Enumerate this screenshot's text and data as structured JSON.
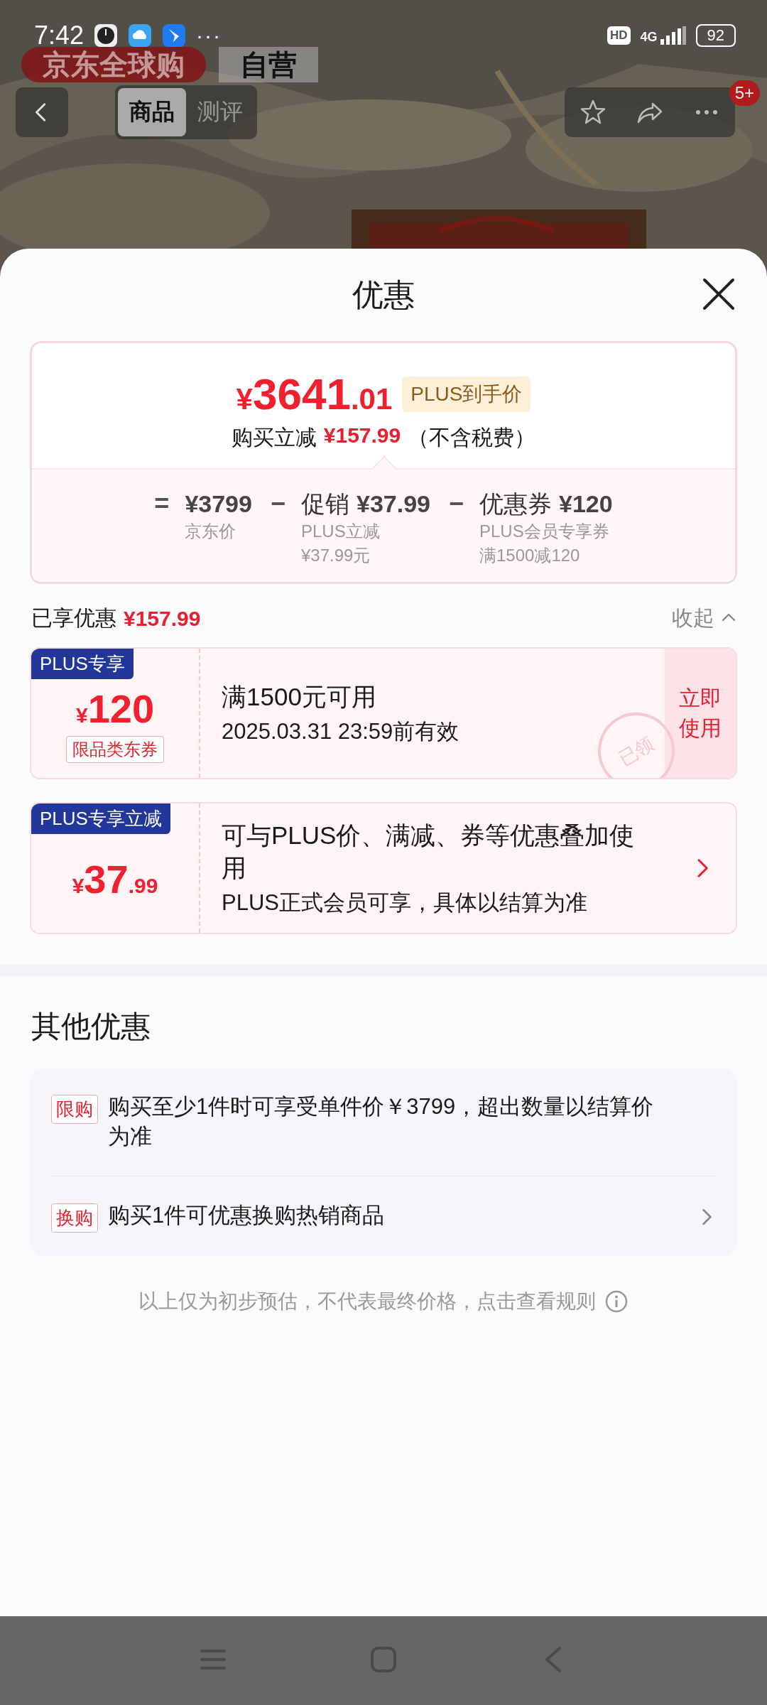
{
  "status_bar": {
    "time": "7:42",
    "more": "···",
    "hd": "HD",
    "network": "4G",
    "battery": "92"
  },
  "store_header": {
    "logo": "京东全球购",
    "badge": "自营"
  },
  "nav": {
    "tabs": [
      {
        "label": "商品",
        "selected": true
      },
      {
        "label": "测评",
        "selected": false
      }
    ],
    "more_badge": "5+"
  },
  "sheet": {
    "title": "优惠"
  },
  "price_card": {
    "currency": "¥",
    "price_integer": "3641",
    "price_decimal": ".01",
    "price_tag": "PLUS到手价",
    "savings_label": "购买立减",
    "savings_amount": "¥157.99",
    "savings_note": "（不含税费）",
    "breakdown": [
      {
        "operator": "=",
        "amount": "¥3799",
        "lines": [
          "京东价"
        ]
      },
      {
        "operator": "−",
        "prefix": "促销",
        "amount": "¥37.99",
        "lines": [
          "PLUS立减",
          "¥37.99元"
        ]
      },
      {
        "operator": "−",
        "prefix": "优惠券",
        "amount": "¥120",
        "lines": [
          "PLUS会员专享券",
          "满1500减120"
        ]
      }
    ]
  },
  "enjoyed": {
    "label": "已享优惠",
    "amount": "¥157.99",
    "toggle": "收起",
    "expanded": true
  },
  "coupons": [
    {
      "kind": "coupon",
      "tag": "PLUS专享",
      "currency": "¥",
      "amount": "120",
      "type_label": "限品类东券",
      "condition": "满1500元可用",
      "validity": "2025.03.31 23:59前有效",
      "action": "立即使用",
      "stamp": "已领"
    },
    {
      "kind": "promotion",
      "tag": "PLUS专享立减",
      "currency": "¥",
      "amount": "37",
      "decimal": ".99",
      "description": "可与PLUS价、满减、券等优惠叠加使用",
      "note": "PLUS正式会员可享，具体以结算为准"
    }
  ],
  "other": {
    "title": "其他优惠",
    "items": [
      {
        "kind": "info",
        "tag": "限购",
        "text": "购买至少1件时可享受单件价￥3799，超出数量以结算价为准"
      },
      {
        "kind": "link",
        "tag": "换购",
        "text": "购买1件可优惠换购热销商品"
      }
    ]
  },
  "footnote": "以上仅为初步预估，不代表最终价格，点击查看规则"
}
